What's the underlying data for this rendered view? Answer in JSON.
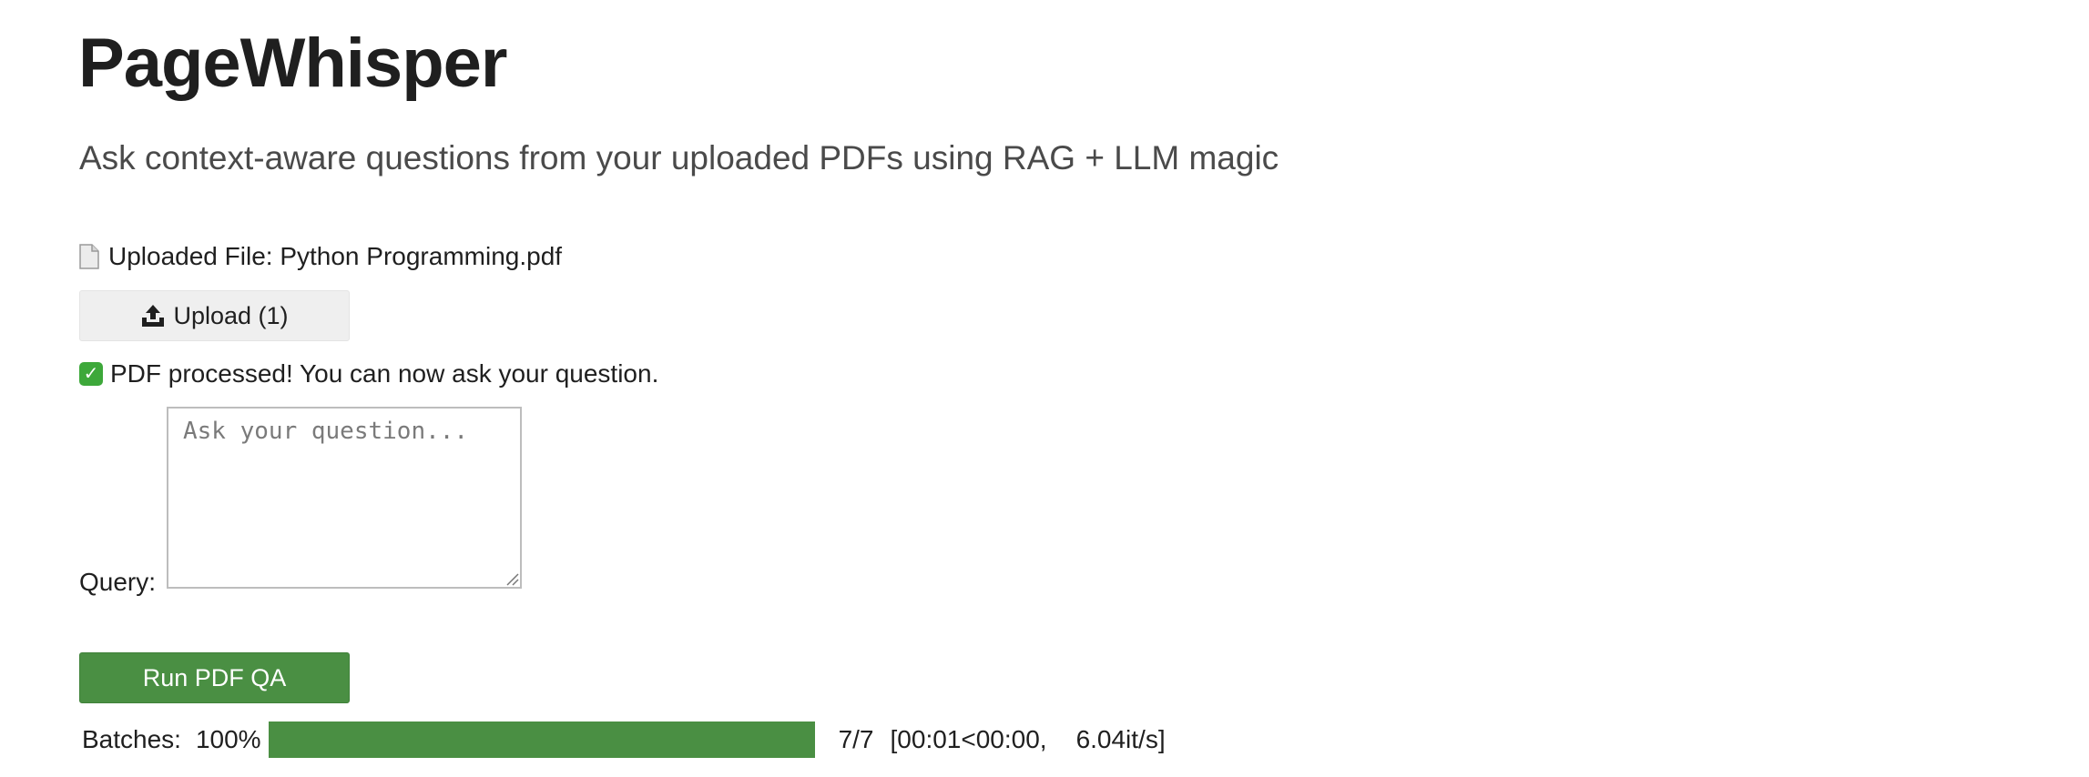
{
  "app": {
    "title": "PageWhisper",
    "subtitle": "Ask context-aware questions from your uploaded PDFs using RAG + LLM magic"
  },
  "upload": {
    "file_icon": "document-icon",
    "file_text": "Uploaded File: Python Programming.pdf",
    "button_icon": "upload-icon",
    "button_label": "Upload (1)"
  },
  "status": {
    "icon": "check-mark-icon",
    "text": "PDF processed! You can now ask your question."
  },
  "query": {
    "label": "Query:",
    "placeholder": "Ask your question...",
    "value": ""
  },
  "run_button": {
    "label": "Run PDF QA"
  },
  "progress": {
    "label": "Batches:",
    "percent_text": "100%",
    "fraction": 1.0,
    "count": "7/7",
    "time": "[00:01<00:00,",
    "rate": "6.04it/s]"
  },
  "colors": {
    "accent_green": "#4a8f43",
    "check_green": "#3da83a",
    "upload_button_bg": "#efefef",
    "text": "#1f1f1f",
    "subtitle": "#4a4a4a"
  }
}
